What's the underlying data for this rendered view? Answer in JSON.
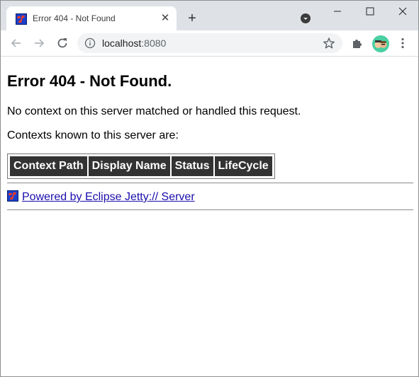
{
  "browser": {
    "tab": {
      "title": "Error 404 - Not Found",
      "favicon": "jetty-icon"
    },
    "address_bar": {
      "host": "localhost",
      "port": ":8080"
    },
    "icons": [
      "back-icon",
      "forward-icon",
      "reload-icon",
      "info-icon",
      "star-icon",
      "extensions-icon",
      "menu-icon",
      "tab-search-icon",
      "minimize-icon",
      "maximize-icon",
      "close-icon"
    ]
  },
  "page": {
    "heading": "Error 404 - Not Found.",
    "message": "No context on this server matched or handled this request.",
    "contexts_label": "Contexts known to this server are:",
    "table": {
      "headers": [
        "Context Path",
        "Display Name",
        "Status",
        "LifeCycle"
      ]
    },
    "footer_link": "Powered by Eclipse Jetty:// Server"
  },
  "colors": {
    "table_header_bg": "#333333",
    "link": "#1a0dab",
    "tabstrip": "#dee1e6"
  }
}
